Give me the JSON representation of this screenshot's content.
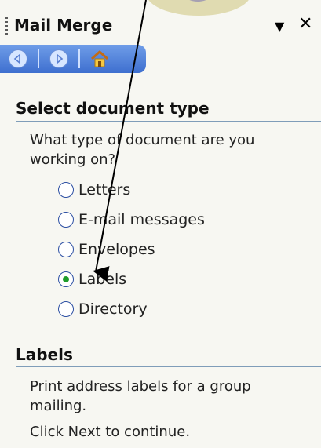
{
  "pane": {
    "title": "Mail Merge",
    "dropdown_icon": "dropdown-arrow-icon",
    "close_icon": "close-icon"
  },
  "nav": {
    "back_icon": "back-arrow-icon",
    "forward_icon": "forward-arrow-icon",
    "home_icon": "home-icon"
  },
  "select_section": {
    "heading": "Select document type",
    "question_line1": "What type of document are you",
    "question_line2": "working on?",
    "options": [
      {
        "label": "Letters",
        "selected": false
      },
      {
        "label": "E-mail messages",
        "selected": false
      },
      {
        "label": "Envelopes",
        "selected": false
      },
      {
        "label": "Labels",
        "selected": true
      },
      {
        "label": "Directory",
        "selected": false
      }
    ]
  },
  "labels_section": {
    "heading": "Labels",
    "description_line1": "Print address labels for a group",
    "description_line2": "mailing.",
    "instruction": "Click Next to continue."
  },
  "colors": {
    "nav_gradient_top": "#6f9de8",
    "nav_gradient_bottom": "#3e6fcf",
    "rule": "#7f9db9",
    "radio_selected": "#1e9c2a"
  }
}
